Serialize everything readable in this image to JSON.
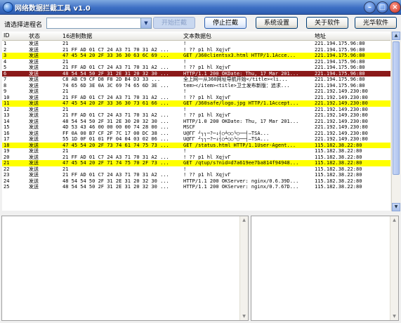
{
  "window": {
    "title": "网络数据拦截工具 v1.0"
  },
  "toolbar": {
    "process_label": "请选择进程名",
    "process_value": "",
    "buttons": [
      "开始拦截",
      "停止拦截",
      "系统设置",
      "关于软件",
      "光华软件"
    ]
  },
  "table": {
    "headers": [
      "ID",
      "状态",
      "16进制数据",
      "文本数据包",
      "地址"
    ],
    "rows": [
      {
        "id": "1",
        "status": "发送",
        "hex": "21",
        "text": "!",
        "addr": "221.194.175.96:80",
        "hl": ""
      },
      {
        "id": "2",
        "status": "发送",
        "hex": "21 FF AD 01 C7 24 A3 71 70 31 A2 ...",
        "text": "!  ??  p1          hl  XqjvΓ",
        "addr": "221.194.175.96:80",
        "hl": ""
      },
      {
        "id": "3",
        "status": "发送",
        "hex": "47 45 54 20 2F 33 36 30 63 6C 69 ...",
        "text": "GET /360clientsx3.html HTTP/1.1Acce...",
        "addr": "221.194.175.96:80",
        "hl": "y"
      },
      {
        "id": "4",
        "status": "发送",
        "hex": "21",
        "text": "!",
        "addr": "221.194.175.96:80",
        "hl": ""
      },
      {
        "id": "5",
        "status": "发送",
        "hex": "21 FF AD 01 C7 24 A3 71 70 31 A2 ...",
        "text": "!  ??  p1          hl  XqjvΓ",
        "addr": "221.194.175.96:80",
        "hl": ""
      },
      {
        "id": "6",
        "status": "发送",
        "hex": "48 54 54 50 2F 31 2E 31 20 32 30 ...",
        "text": "HTTP/1.1 200 OKDate: Thu, 17 Mar 201...",
        "addr": "221.194.175.96:80",
        "hl": "r"
      },
      {
        "id": "7",
        "status": "发送",
        "hex": "C8 AB C9 CF D8 F8 2D B4 D3 33 ...",
        "text": "全上网一从360网址导航开始</title><li...",
        "addr": "221.194.175.96:80",
        "hl": ""
      },
      {
        "id": "8",
        "status": "发送",
        "hex": "74 65 6D 3E 0A 3C 69 74 65 6D 3E ...",
        "text": "tem></item><title>卫士发布新版：追求...",
        "addr": "221.194.175.96:80",
        "hl": ""
      },
      {
        "id": "9",
        "status": "发送",
        "hex": "21",
        "text": "!",
        "addr": "221.192.149.230:80",
        "hl": ""
      },
      {
        "id": "10",
        "status": "发送",
        "hex": "21 FF AD 01 C7 24 A3 71 70 31 A2 ...",
        "text": "!  ??  p1          hl  XqjvΓ",
        "addr": "221.192.149.230:80",
        "hl": ""
      },
      {
        "id": "11",
        "status": "发送",
        "hex": "47 45 54 20 2F 33 36 30 73 61 66 ...",
        "text": "GET /360safe/logo.jpg HTTP/1.1Accept...",
        "addr": "221.192.149.230:80",
        "hl": "y"
      },
      {
        "id": "12",
        "status": "发送",
        "hex": "21",
        "text": "!",
        "addr": "221.192.149.230:80",
        "hl": ""
      },
      {
        "id": "13",
        "status": "发送",
        "hex": "21 FF AD 01 C7 24 A3 71 70 31 A2 ...",
        "text": "!  ??  p1          hl  XqjvΓ",
        "addr": "221.192.149.230:80",
        "hl": ""
      },
      {
        "id": "14",
        "status": "发送",
        "hex": "48 54 54 50 2F 31 2E 30 20 32 30 ...",
        "text": "HTTP/1.0 200 OKDate: Thu, 17 Mar 201...",
        "addr": "221.192.149.230:80",
        "hl": ""
      },
      {
        "id": "15",
        "status": "发送",
        "hex": "4D 53 43 46 00 00 00 00 74 28 00 ...",
        "text": "MSCF",
        "addr": "221.192.149.230:80",
        "hl": ""
      },
      {
        "id": "16",
        "status": "发送",
        "hex": "FF 0A 00 B7 CF 2F 7C 17 00 DC 38 ...",
        "text": "U@ΓΓ  ┘┐┐─?─↓┤○┴○○└○──┤—TSA...",
        "addr": "221.192.149.230:80",
        "hl": ""
      },
      {
        "id": "17",
        "status": "发送",
        "hex": "55 1D 0F 01 01 FF 04 04 03 02 06 ...",
        "text": "U@ΓΓ  ┘┐┐─?─↓┤○┴○○└○──┤—TSA...",
        "addr": "221.192.149.230:80",
        "hl": ""
      },
      {
        "id": "18",
        "status": "发送",
        "hex": "47 45 54 20 2F 73 74 61 74 75 73 ...",
        "text": "GET /status.html HTTP/1.1User-Agent...",
        "addr": "115.182.38.22:80",
        "hl": "y"
      },
      {
        "id": "19",
        "status": "发送",
        "hex": "21",
        "text": "!",
        "addr": "115.182.38.22:80",
        "hl": ""
      },
      {
        "id": "20",
        "status": "发送",
        "hex": "21 FF AD 01 C7 24 A3 71 70 31 A2 ...",
        "text": "!  ??  p1          hl  XqjvΓ",
        "addr": "115.182.38.22:80",
        "hl": ""
      },
      {
        "id": "21",
        "status": "发送",
        "hex": "47 45 54 20 2F 71 74 75 70 2F 73 ...",
        "text": "GET /qtup/s?nid=d7a619ee7ba814f94948...",
        "addr": "115.182.38.22:80",
        "hl": "y"
      },
      {
        "id": "22",
        "status": "发送",
        "hex": "21",
        "text": "!",
        "addr": "115.182.38.22:80",
        "hl": ""
      },
      {
        "id": "23",
        "status": "发送",
        "hex": "21 FF AD 01 C7 24 A3 71 70 31 A2 ...",
        "text": "!  ??  p1          hl  XqjvΓ",
        "addr": "115.182.38.22:80",
        "hl": ""
      },
      {
        "id": "24",
        "status": "发送",
        "hex": "48 54 54 50 2F 31 2E 31 20 32 30 ...",
        "text": "HTTP/1.1 200 OKServer: nginx/0.6.39D...",
        "addr": "115.182.38.22:80",
        "hl": ""
      },
      {
        "id": "25",
        "status": "发送",
        "hex": "48 54 54 50 2F 31 2E 31 20 32 30 ...",
        "text": "HTTP/1.1 200 OKServer: nginx/0.7.67D...",
        "addr": "115.182.38.22:80",
        "hl": ""
      }
    ]
  }
}
